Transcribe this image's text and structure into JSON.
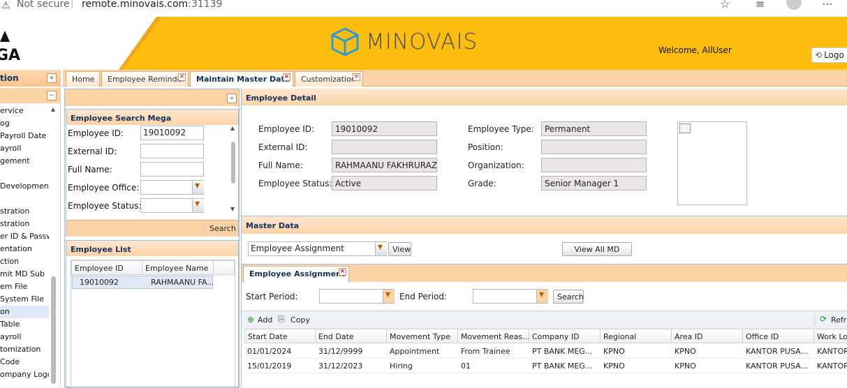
{
  "browser": {
    "security_label": "Not secure",
    "url_domain": "remote.minovais.com",
    "url_port": ":31139"
  },
  "header": {
    "logo_partial": "GA",
    "brand_name": "MINOVAIS",
    "welcome": "Welcome, AllUser",
    "logout_label": "Logo"
  },
  "left_nav": {
    "title": "tion",
    "items": [
      "ervice",
      "og",
      " Payroll Date",
      "ayroll",
      "gement",
      "",
      "Development",
      "",
      "stration",
      "stration",
      "er ID & Passw",
      "entation",
      "ction",
      "mit MD Sub",
      "em File",
      "System File",
      "on",
      "Table",
      "ayroll",
      "tomization",
      " Code",
      "ompany Logo"
    ]
  },
  "tabs": [
    {
      "label": "Home"
    },
    {
      "label": "Employee Reminder"
    },
    {
      "label": "Maintain Master Data"
    },
    {
      "label": "Customization"
    }
  ],
  "search_panel": {
    "title": "Employee Search Mega",
    "fields": {
      "employee_id_label": "Employee ID:",
      "employee_id_value": "19010092",
      "external_id_label": "External ID:",
      "full_name_label": "Full Name:",
      "office_label": "Employee Office:",
      "status_label": "Employee Status:"
    },
    "search_label": "Search"
  },
  "employee_list": {
    "title": "Employee List",
    "columns": [
      "Employee ID",
      "Employee Name"
    ],
    "rows": [
      [
        "19010092",
        "RAHMAANU FA..."
      ]
    ]
  },
  "employee_detail": {
    "title": "Employee Detail",
    "employee_id_label": "Employee ID:",
    "employee_id": "19010092",
    "external_id_label": "External ID:",
    "external_id": "",
    "full_name_label": "Full Name:",
    "full_name": "RAHMAANU FAKHRURAZI",
    "status_label": "Employee Status:",
    "status": "Active",
    "type_label": "Employee Type:",
    "type": "Permanent",
    "position_label": "Position:",
    "position": "",
    "organization_label": "Organization:",
    "organization": "",
    "grade_label": "Grade:",
    "grade": "Senior Manager 1"
  },
  "master_data": {
    "title": "Master Data",
    "selected": "Employee Assignment",
    "view_label": "View",
    "view_all_label": "View All MD"
  },
  "assignment": {
    "tab_label": "Employee Assignment",
    "start_period_label": "Start Period:",
    "end_period_label": "End Period:",
    "search_label": "Search",
    "add_label": "Add",
    "copy_label": "Copy",
    "refresh_label": "Refr",
    "columns": [
      "Start Date",
      "End Date",
      "Movement Type",
      "Movement Reas...",
      "Company ID",
      "Regional",
      "Area ID",
      "Office ID",
      "Work Lo"
    ],
    "rows": [
      [
        "01/01/2024",
        "31/12/9999",
        "Appointment",
        "From Trainee",
        "PT BANK MEG...",
        "KPNO",
        "KPNO",
        "KANTOR PUSA...",
        "KANTOR"
      ],
      [
        "15/01/2019",
        "31/12/2023",
        "Hiring",
        "01",
        "PT BANK MEG...",
        "KPNO",
        "KPNO",
        "KANTOR PUSA...",
        "KANTOR"
      ]
    ]
  },
  "colors": {
    "header_yellow": "#fcbd0e",
    "panel_orange": "#fbd3a6",
    "panel_border": "#9fbce6",
    "title_text": "#15305a"
  }
}
